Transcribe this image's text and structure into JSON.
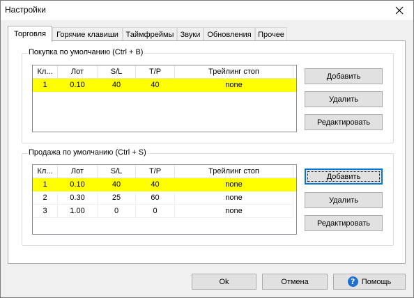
{
  "window": {
    "title": "Настройки"
  },
  "tabs": [
    {
      "label": "Торговля",
      "active": true
    },
    {
      "label": "Горячие клавиши",
      "active": false
    },
    {
      "label": "Таймфреймы",
      "active": false
    },
    {
      "label": "Звуки",
      "active": false
    },
    {
      "label": "Обновления",
      "active": false
    },
    {
      "label": "Прочее",
      "active": false
    }
  ],
  "columns": [
    "Кл...",
    "Лот",
    "S/L",
    "T/P",
    "Трейлинг стоп"
  ],
  "buy": {
    "title": "Покупка по умолчанию (Ctrl + B)",
    "rows": [
      {
        "key": "1",
        "lot": "0.10",
        "sl": "40",
        "tp": "40",
        "trailing": "none",
        "highlight": true
      }
    ],
    "add_label": "Добавить",
    "delete_label": "Удалить",
    "edit_label": "Редактировать"
  },
  "sell": {
    "title": "Продажа по умолчанию (Ctrl + S)",
    "rows": [
      {
        "key": "1",
        "lot": "0.10",
        "sl": "40",
        "tp": "40",
        "trailing": "none",
        "highlight": true
      },
      {
        "key": "2",
        "lot": "0.30",
        "sl": "25",
        "tp": "60",
        "trailing": "none",
        "highlight": false
      },
      {
        "key": "3",
        "lot": "1.00",
        "sl": "0",
        "tp": "0",
        "trailing": "none",
        "highlight": false
      }
    ],
    "add_label": "Добавить",
    "delete_label": "Удалить",
    "edit_label": "Редактировать"
  },
  "footer": {
    "ok_label": "Ok",
    "cancel_label": "Отмена",
    "help_label": "Помощь",
    "help_icon": "?"
  },
  "colors": {
    "highlight": "#ffff00",
    "focus_border": "#0078d7",
    "help_icon": "#1e6fd0"
  }
}
